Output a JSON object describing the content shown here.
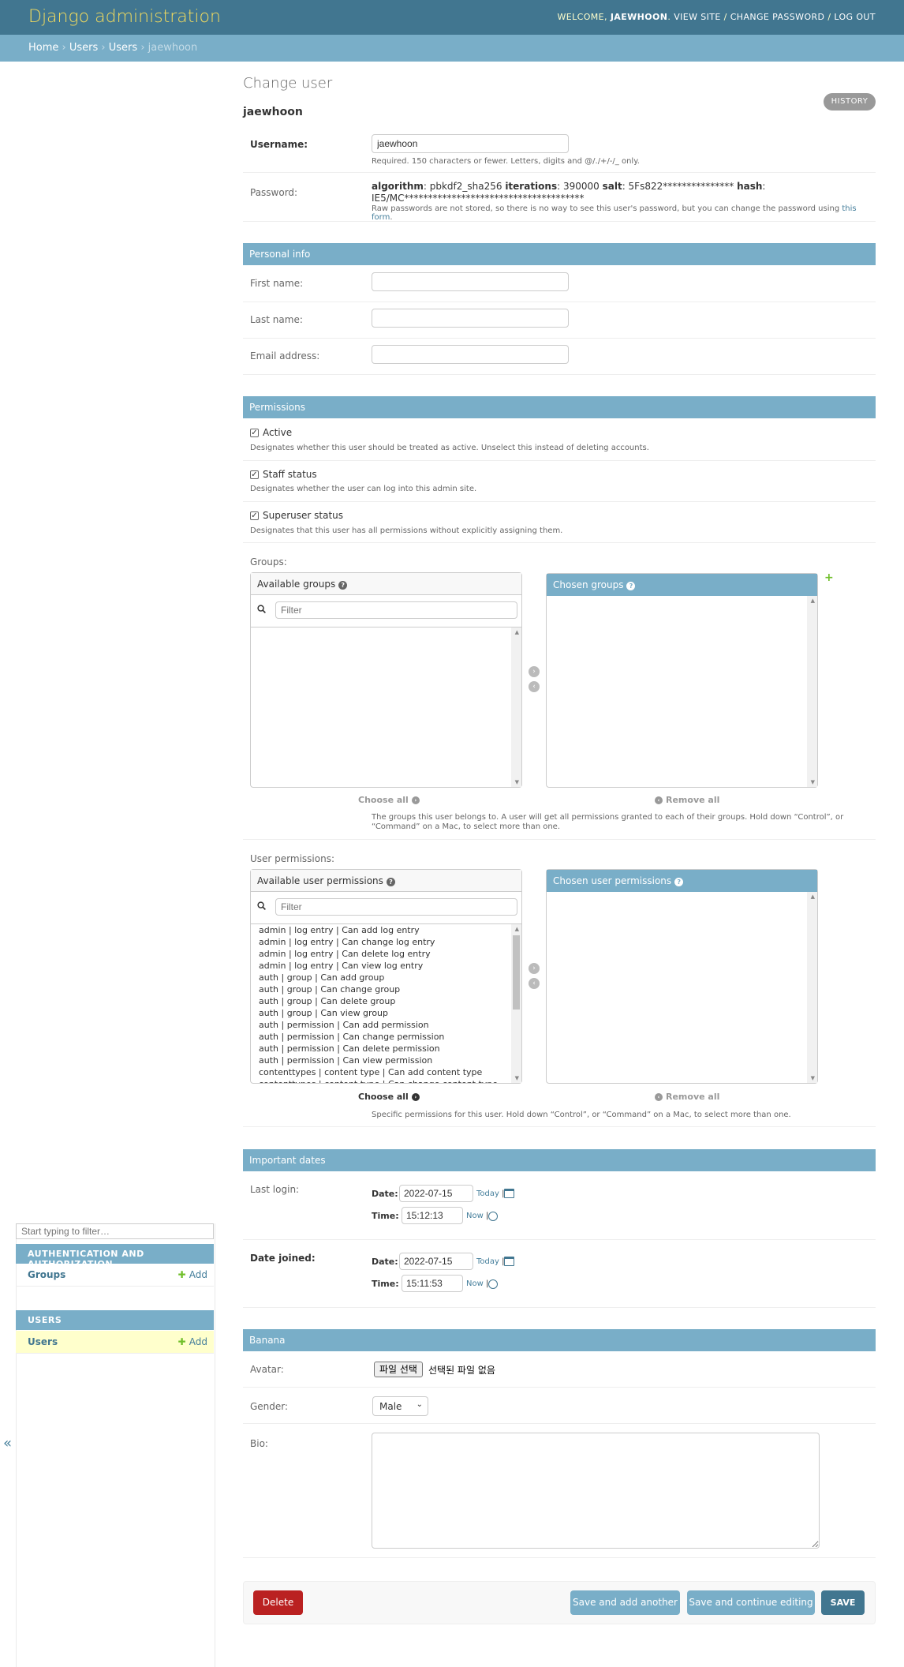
{
  "header": {
    "brand": "Django administration",
    "welcome": "WELCOME, ",
    "username": "JAEWHOON",
    "view_site": "VIEW SITE",
    "change_password": "CHANGE PASSWORD",
    "log_out": "LOG OUT",
    "sep": " / "
  },
  "breadcrumbs": {
    "home": "Home",
    "app": "Users",
    "model": "Users",
    "current": "jaewhoon",
    "sep": "›"
  },
  "sidebar": {
    "filter_placeholder": "Start typing to filter…",
    "modules": [
      {
        "caption": "AUTHENTICATION AND AUTHORIZATION",
        "items": [
          {
            "name": "Groups",
            "add": "Add"
          }
        ]
      },
      {
        "caption": "USERS",
        "items": [
          {
            "name": "Users",
            "add": "Add"
          }
        ]
      }
    ],
    "toggle": "«"
  },
  "page": {
    "title": "Change user",
    "object": "jaewhoon",
    "history": "HISTORY"
  },
  "account": {
    "username_label": "Username:",
    "username_value": "jaewhoon",
    "username_help": "Required. 150 characters or fewer. Letters, digits and @/./+/-/_ only.",
    "password_label": "Password:",
    "password_line1_k1": "algorithm",
    "password_line1_v1": ": pbkdf2_sha256 ",
    "password_line1_k2": "iterations",
    "password_line1_v2": ": 390000 ",
    "password_line1_k3": "salt",
    "password_line1_v3": ": 5Fs822*************** ",
    "password_line1_k4": "hash",
    "password_line1_v4": ":",
    "password_line2": "IE5/MC**************************************",
    "password_help": "Raw passwords are not stored, so there is no way to see this user's password, but you can change the password using ",
    "password_help_link": "this form",
    "password_help_end": "."
  },
  "personal": {
    "caption": "Personal info",
    "first_name": "First name:",
    "last_name": "Last name:",
    "email": "Email address:"
  },
  "permissions": {
    "caption": "Permissions",
    "active": {
      "label": "Active",
      "help": "Designates whether this user should be treated as active. Unselect this instead of deleting accounts.",
      "checked": true
    },
    "staff": {
      "label": "Staff status",
      "help": "Designates whether the user can log into this admin site.",
      "checked": true
    },
    "superuser": {
      "label": "Superuser status",
      "help": "Designates that this user has all permissions without explicitly assigning them.",
      "checked": true
    },
    "groups_label": "Groups:",
    "available_groups": "Available groups",
    "chosen_groups": "Chosen groups",
    "filter": "Filter",
    "choose_all": "Choose all",
    "remove_all": "Remove all",
    "groups_help": "The groups this user belongs to. A user will get all permissions granted to each of their groups. Hold down “Control”, or “Command” on a Mac, to select more than one.",
    "user_perms_label": "User permissions:",
    "available_perms": "Available user permissions",
    "chosen_perms": "Chosen user permissions",
    "perms_help": "Specific permissions for this user. Hold down “Control”, or “Command” on a Mac, to select more than one.",
    "perm_options": [
      "admin | log entry | Can add log entry",
      "admin | log entry | Can change log entry",
      "admin | log entry | Can delete log entry",
      "admin | log entry | Can view log entry",
      "auth | group | Can add group",
      "auth | group | Can change group",
      "auth | group | Can delete group",
      "auth | group | Can view group",
      "auth | permission | Can add permission",
      "auth | permission | Can change permission",
      "auth | permission | Can delete permission",
      "auth | permission | Can view permission",
      "contenttypes | content type | Can add content type",
      "contenttypes | content type | Can change content type"
    ]
  },
  "dates": {
    "caption": "Important dates",
    "last_login": "Last login:",
    "date_joined": "Date joined:",
    "date_label": "Date:",
    "time_label": "Time:",
    "today": "Today",
    "now": "Now",
    "pipe": "|",
    "last_login_date": "2022-07-15",
    "last_login_time": "15:12:13",
    "joined_date": "2022-07-15",
    "joined_time": "15:11:53"
  },
  "banana": {
    "caption": "Banana",
    "avatar_label": "Avatar:",
    "file_button": "파일 선택",
    "file_none": "선택된 파일 없음",
    "gender_label": "Gender:",
    "gender_value": "Male",
    "bio_label": "Bio:"
  },
  "submit": {
    "delete": "Delete",
    "save_add": "Save and add another",
    "save_continue": "Save and continue editing",
    "save": "SAVE"
  },
  "colors": {
    "header": "#417690",
    "breadcrumbs": "#79aec8",
    "brand": "#f5dd5d",
    "delete": "#ba2121",
    "secondary_button": "#79aec8",
    "primary_button": "#417690"
  }
}
